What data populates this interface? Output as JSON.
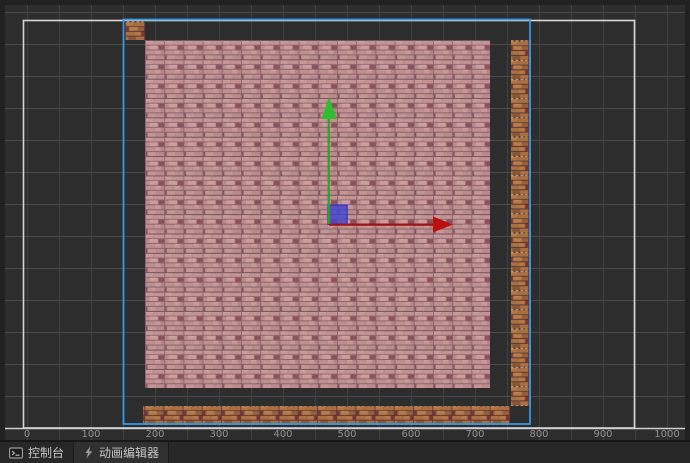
{
  "scene": {
    "ruler_labels": [
      "0",
      "100",
      "200",
      "300",
      "400",
      "500",
      "600",
      "700",
      "800",
      "900",
      "1000"
    ],
    "selection": {
      "present": true
    },
    "gizmo": {
      "axes": [
        "y-green-up",
        "x-red-right"
      ],
      "selected_node": "blue-tile"
    }
  },
  "statusbar": {
    "tabs": [
      {
        "label": "控制台",
        "icon": "console-icon",
        "active": false
      },
      {
        "label": "动画编辑器",
        "icon": "animation-icon",
        "active": true
      }
    ]
  },
  "colors": {
    "background": "#2d2d2d",
    "grid_line": "#424242",
    "design_border": "#d6d6d6",
    "selection_blue": "#3398e6",
    "gizmo_green": "#2ebf2e",
    "gizmo_red_head": "#bb1010",
    "gizmo_red_shaft": "#9e1414",
    "selected_node_blue": "#4343d2",
    "tile_pink": "#bc8b8b",
    "tile_brown": "#a4693f"
  }
}
